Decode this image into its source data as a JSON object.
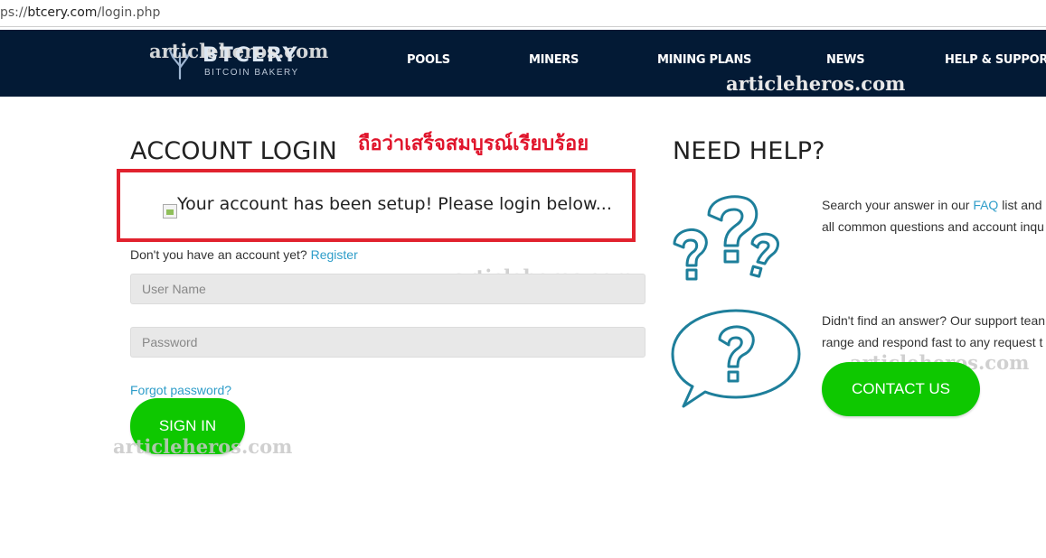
{
  "browser": {
    "url_prefix": "ps://",
    "url_host": "btcery.com",
    "url_path": "/login.php"
  },
  "nav": {
    "logo": {
      "brand": "BTCERY",
      "tagline": "BITCOIN BAKERY"
    },
    "items": [
      {
        "label": "POOLS"
      },
      {
        "label": "MINERS"
      },
      {
        "label": "MINING PLANS"
      },
      {
        "label": "NEWS"
      },
      {
        "label": "HELP & SUPPORT"
      }
    ]
  },
  "watermark": {
    "text": "articleheros.com"
  },
  "login": {
    "title": "ACCOUNT LOGIN",
    "annotation": "ถือว่าเสร็จสมบูรณ์เรียบร้อย",
    "setup_message": "Your account has been setup! Please login below...",
    "no_account_text": "Don't you have an account yet?",
    "register_link": "Register",
    "username_placeholder": "User Name",
    "password_placeholder": "Password",
    "forgot_link": "Forgot password?",
    "sign_in_label": "SIGN IN"
  },
  "help": {
    "title": "NEED HELP?",
    "faq_line1_pre": "Search your answer in our",
    "faq_link": "FAQ",
    "faq_line1_post": "list and",
    "faq_line2": "all common questions and account inqu",
    "support_line1": "Didn't find an answer? Our support tean",
    "support_line2": "range and respond fast to any request t",
    "contact_label": "CONTACT US",
    "icons": [
      "question-marks-icon",
      "speech-bubble-question-icon"
    ]
  },
  "colors": {
    "nav_bg": "#031a35",
    "accent_green": "#0ec800",
    "link_blue": "#2e9dc9",
    "annotation_red": "#e1222e"
  }
}
